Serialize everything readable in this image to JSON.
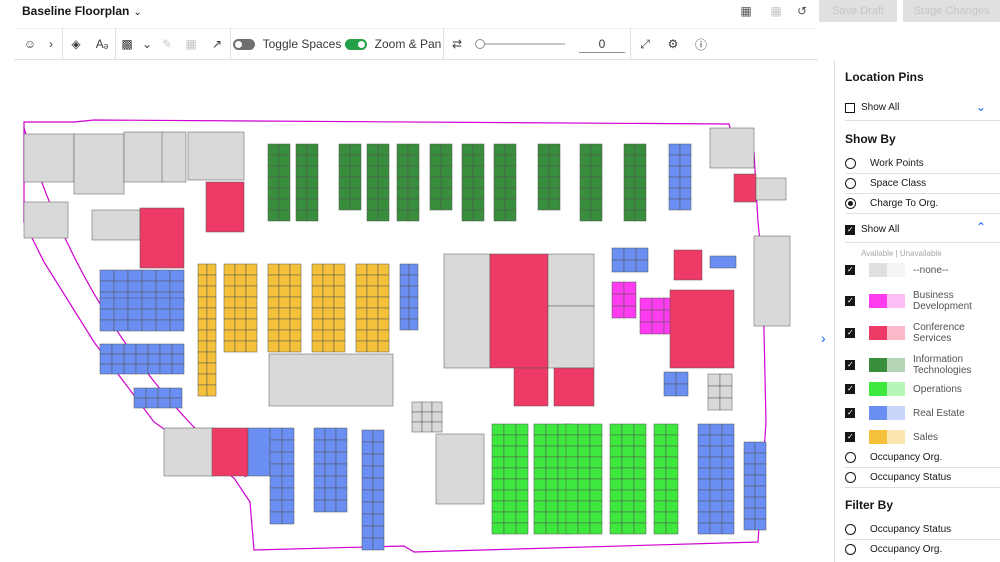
{
  "app": {
    "title": "Baseline Floorplan"
  },
  "top_actions": {
    "save_draft": "Save Draft",
    "stage_changes": "Stage Changes"
  },
  "toolbar": {
    "toggle_spaces": "Toggle Spaces",
    "zoom_pan": "Zoom & Pan",
    "value": "0"
  },
  "panel": {
    "location_pins": "Location Pins",
    "show_all": "Show All",
    "show_by": "Show By",
    "show_by_options": [
      "Work Points",
      "Space Class",
      "Charge To Org."
    ],
    "available_unavailable": "Available | Unavailable",
    "legend": [
      {
        "label": "--none--",
        "color": "#e0e0e0",
        "light": "#f4f4f4"
      },
      {
        "label": "Business Development",
        "color": "#ff3bf0",
        "light": "#ffbdf7"
      },
      {
        "label": "Conference Services",
        "color": "#ee3a66",
        "light": "#fbb8c8"
      },
      {
        "label": "Information Technologies",
        "color": "#388e3c",
        "light": "#b4d6b5"
      },
      {
        "label": "Operations",
        "color": "#3fe83f",
        "light": "#b8f6b8"
      },
      {
        "label": "Real Estate",
        "color": "#6a8ef2",
        "light": "#c8d6fb"
      },
      {
        "label": "Sales",
        "color": "#f5c13b",
        "light": "#fbe6b0"
      }
    ],
    "occupancy_options": [
      "Occupancy Org.",
      "Occupancy Status"
    ],
    "filter_by": "Filter By",
    "filter_options": [
      "Occupancy Status",
      "Occupancy Org."
    ]
  },
  "colors": {
    "grey": "#d9d9d9",
    "pink": "#ee3a66",
    "magenta": "#ff3bf0",
    "darkgreen": "#388e3c",
    "green": "#3fe83f",
    "blue": "#6a8ef2",
    "yellow": "#f5c13b",
    "wall": "#d000d0"
  }
}
